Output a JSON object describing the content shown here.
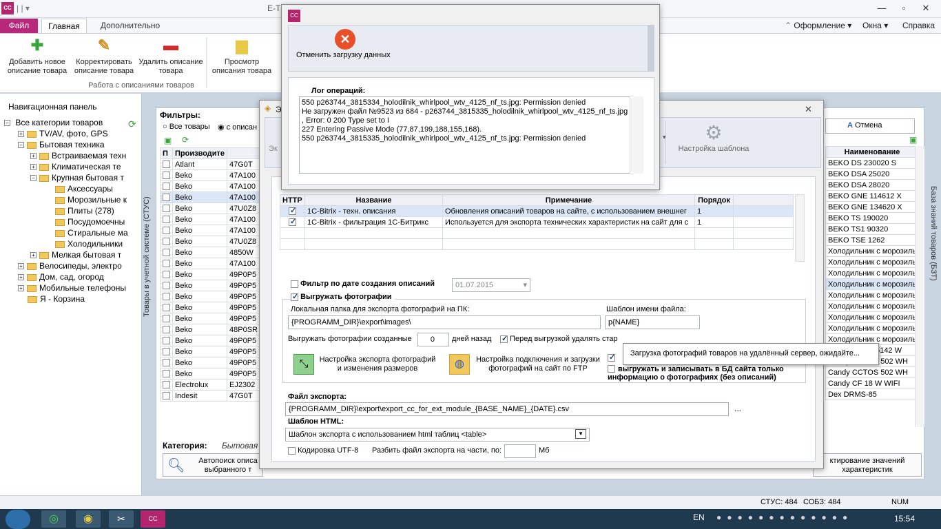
{
  "window": {
    "title": "E-T",
    "logo": "CC"
  },
  "ribbon": {
    "tabs": [
      "Файл",
      "Главная",
      "Дополнительно"
    ],
    "right_links": [
      "Оформление",
      "Окна",
      "Справка"
    ],
    "buttons": [
      {
        "label": "Добавить новое описание товара",
        "icon": "plus-icon"
      },
      {
        "label": "Корректировать описание товара",
        "icon": "pencil-icon"
      },
      {
        "label": "Удалить описание товара",
        "icon": "minus-icon"
      },
      {
        "label": "Просмотр описания товара",
        "icon": "document-icon"
      }
    ],
    "group_label": "Работа с описаниями товаров"
  },
  "nav": {
    "title": "Навигационная панель",
    "items": [
      "Все категории товаров",
      "TV/AV, фото, GPS",
      "Бытовая техника",
      "Встраиваемая техн",
      "Климатическая те",
      "Крупная бытовая т",
      "Аксессуары",
      "Морозильные к",
      "Плиты (278)",
      "Посудомоечны",
      "Стиральные ма",
      "Холодильники",
      "Мелкая бытовая т",
      "Велосипеды, электро",
      "Дом, сад, огород",
      "Мобильные телефоны",
      "Я - Корзина"
    ]
  },
  "main": {
    "side_label": "Товары в учетной системе (СТУС)",
    "right_side_label": "База знаний товаров (БЗТ)",
    "filters_label": "Фильтры:",
    "radio_all": "Все товары",
    "radio_desc": "с описан",
    "col_p": "П",
    "col_maker": "Производите",
    "rows": [
      [
        "Atlant",
        "47G0T"
      ],
      [
        "Beko",
        "47A100"
      ],
      [
        "Beko",
        "47A100"
      ],
      [
        "Beko",
        "47A100"
      ],
      [
        "Beko",
        "47U0Z8"
      ],
      [
        "Beko",
        "47A100"
      ],
      [
        "Beko",
        "47A100"
      ],
      [
        "Beko",
        "47U0Z8"
      ],
      [
        "Beko",
        "4850W"
      ],
      [
        "Beko",
        "47A100"
      ],
      [
        "Beko",
        "49P0P5"
      ],
      [
        "Beko",
        "49P0P5"
      ],
      [
        "Beko",
        "49P0P5"
      ],
      [
        "Beko",
        "49P0P5"
      ],
      [
        "Beko",
        "49P0P5"
      ],
      [
        "Beko",
        "48P0SR"
      ],
      [
        "Beko",
        "49P0P5"
      ],
      [
        "Beko",
        "49P0P5"
      ],
      [
        "Beko",
        "49P0P5"
      ],
      [
        "Beko",
        "49P0P5"
      ],
      [
        "Electrolux",
        "EJ2302"
      ],
      [
        "Indesit",
        "47G0T"
      ]
    ],
    "category_label": "Категория:",
    "category_value": "Бытовая т",
    "autosearch": "Автопоиск описа выбранного т",
    "edit_values": "ктирование значений характеристик",
    "cancel": "Отмена",
    "col_name": "Наименование",
    "right_rows": [
      "BEKO DS 230020 S",
      "BEKO DSA 25020",
      "BEKO DSA 28020",
      "BEKO GNE 114612 X",
      "BEKO GNE 134620 X",
      "BEKO TS 190020",
      "BEKO TS1 90320",
      "BEKO TSE 1262",
      "Холодильник с морозиль",
      "Холодильник с морозиль",
      "Холодильник с морозиль",
      "Холодильник с морозиль",
      "Холодильник с морозиль",
      "Холодильник с морозиль",
      "Холодильник с морозиль",
      "Холодильник с морозиль",
      "Холодильник с морозиль",
      "Candy CCDS 5142 W",
      "Candy CCTOS 502 WH",
      "Candy CCTOS 502 WH",
      "Candy CF 18 W WIFI",
      "Dex DRMS-85"
    ]
  },
  "export_dialog": {
    "title": "Э",
    "template_settings": "Настройка шаблона",
    "col_http": "HTTP",
    "col_name": "Название",
    "col_note": "Примечание",
    "col_order": "Порядок",
    "rows": [
      {
        "name": "1C-Bitrix - техн. описания",
        "note": "Обновления описаний товаров на сайте, с использованием внешнег",
        "order": "1"
      },
      {
        "name": "1C-Bitrix - фильтрация 1С-Битрикс",
        "note": "Используется для экспорта технических характеристик на сайт для с",
        "order": "1"
      }
    ],
    "date_filter": "Фильтр по дате создания описаний",
    "date_value": "01.07.2015",
    "export_photos": "Выгружать фотографии",
    "local_folder_label": "Локальная папка для экспорта фотографий на ПК:",
    "local_folder": "{PROGRAMM_DIR}\\export\\images\\",
    "name_template_label": "Шаблон имени файла:",
    "name_template": "p{NAME}",
    "photos_created_label": "Выгружать фотографии созданные",
    "photos_days": "0",
    "days_ago": "дней назад",
    "delete_before": "Перед выгрузкой удалять стар",
    "photo_export_settings": "Настройка экспорта фотографий и изменения размеров",
    "ftp_settings": "Настройка подключения и загрузки фотографий на сайт по FTP",
    "only_photo_info": "выгружать и записывать в БД сайта только информацию о фотографиях (без описаний)",
    "export_file_label": "Файл экспорта:",
    "export_file": "{PROGRAMM_DIR}\\export\\export_cc_for_ext_module_{BASE_NAME}_{DATE}.csv",
    "browse": "...",
    "html_template_label": "Шаблон HTML:",
    "html_template": "Шаблон экспорта с использованием html таблиц <table>",
    "utf8": "Кодировка UTF-8",
    "split_label": "Разбить файл экспорта на части, по:",
    "mb": "Мб"
  },
  "log_dialog": {
    "cancel_load": "Отменить загрузку данных",
    "log_title": "Лог операций:",
    "lines": [
      "550 p263744_3815334_holodilnik_whirlpool_wtv_4125_nf_ts.jpg: Permission denied",
      "Не загружен файл №9523 из 684 - p263744_3815335_holodilnik_whirlpool_wtv_4125_nf_ts.jpg",
      ", Error: 0 200 Type set to I",
      "227 Entering Passive Mode (77,87,199,188,155,168).",
      "550 p263744_3815335_holodilnik_whirlpool_wtv_4125_nf_ts.jpg: Permission denied"
    ]
  },
  "tooltip": "Загрузка фотографий товаров на удалённый сервер, ожидайте...",
  "status": {
    "stus": "СТУС: 484",
    "sobz": "СОБЗ: 484",
    "num": "NUM"
  },
  "taskbar": {
    "lang": "EN",
    "time": "15:54"
  }
}
